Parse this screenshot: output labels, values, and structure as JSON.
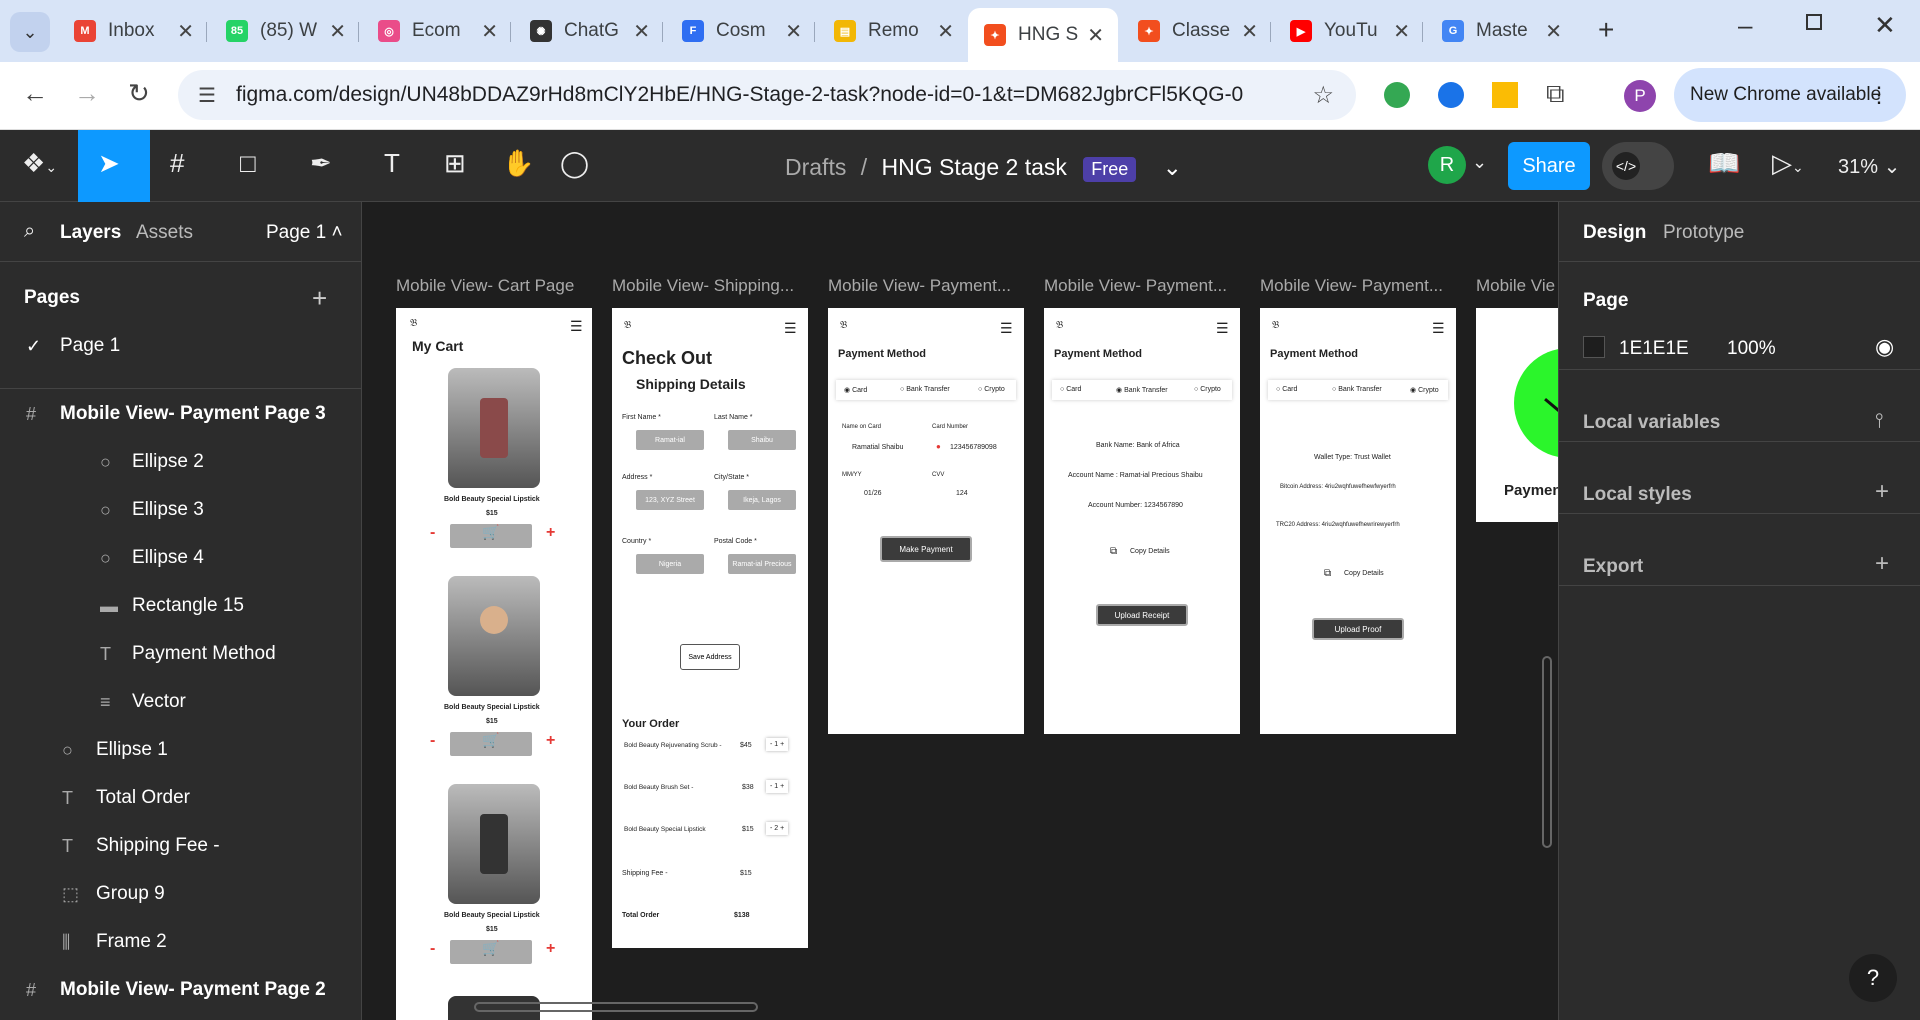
{
  "browser": {
    "tabs": [
      {
        "label": "Inbox",
        "color": "#ea4335",
        "glyph": "M"
      },
      {
        "label": "(85) W",
        "color": "#25d366",
        "glyph": "85"
      },
      {
        "label": "Ecom",
        "color": "#ea4c89",
        "glyph": "◎"
      },
      {
        "label": "ChatG",
        "color": "#333333",
        "glyph": "✺"
      },
      {
        "label": "Cosm",
        "color": "#2f6ef2",
        "glyph": "F"
      },
      {
        "label": "Remo",
        "color": "#f2b705",
        "glyph": "▤"
      },
      {
        "label": "HNG S",
        "color": "#f24e1e",
        "glyph": "✦"
      },
      {
        "label": "Classe",
        "color": "#f24e1e",
        "glyph": "✦"
      },
      {
        "label": "YouTu",
        "color": "#ff0000",
        "glyph": "▶"
      },
      {
        "label": "Maste",
        "color": "#4285f4",
        "glyph": "G"
      }
    ],
    "url": "figma.com/design/UN48bDDAZ9rHd8mClY2HbE/HNG-Stage-2-task?node-id=0-1&t=DM682JgbrCFl5KQG-0",
    "new_chrome": "New Chrome available",
    "profile_initial": "P"
  },
  "figma": {
    "breadcrumb_drafts": "Drafts",
    "separator": "/",
    "file_name": "HNG Stage 2 task",
    "plan_badge": "Free",
    "user_initial": "R",
    "share": "Share",
    "zoom": "31%"
  },
  "left": {
    "tab_layers": "Layers",
    "tab_assets": "Assets",
    "page_selector": "Page 1",
    "pages_heading": "Pages",
    "current_page": "Page 1",
    "layers": [
      {
        "label": "Mobile View- Payment Page 3",
        "icon": "#",
        "indent": 0,
        "bold": true
      },
      {
        "label": "Ellipse 2",
        "icon": "○",
        "indent": 2
      },
      {
        "label": "Ellipse 3",
        "icon": "○",
        "indent": 2
      },
      {
        "label": "Ellipse 4",
        "icon": "○",
        "indent": 2
      },
      {
        "label": "Rectangle 15",
        "icon": "▬",
        "indent": 2
      },
      {
        "label": "Payment Method",
        "icon": "T",
        "indent": 2
      },
      {
        "label": "Vector",
        "icon": "≡",
        "indent": 2
      },
      {
        "label": "Ellipse 1",
        "icon": "○",
        "indent": 1
      },
      {
        "label": "Total Order",
        "icon": "T",
        "indent": 1
      },
      {
        "label": "Shipping Fee -",
        "icon": "T",
        "indent": 1
      },
      {
        "label": "Group 9",
        "icon": "⬚",
        "indent": 1
      },
      {
        "label": "Frame 2",
        "icon": "⫼",
        "indent": 1
      },
      {
        "label": "Mobile View- Payment Page 2",
        "icon": "#",
        "indent": 0,
        "bold": true
      }
    ]
  },
  "canvas": {
    "frame_labels": [
      "Mobile View- Cart Page",
      "Mobile View- Shipping...",
      "Mobile View- Payment...",
      "Mobile View- Payment...",
      "Mobile View- Payment...",
      "Mobile Vie"
    ],
    "cart": {
      "title": "My Cart",
      "items": [
        {
          "name": "Bold Beauty Special Lipstick",
          "price": "$15"
        },
        {
          "name": "Bold Beauty Special Lipstick",
          "price": "$15"
        },
        {
          "name": "Bold Beauty Special Lipstick",
          "price": "$15"
        }
      ],
      "minus": "-",
      "plus": "+"
    },
    "shipping": {
      "title": "Check Out",
      "subtitle": "Shipping Details",
      "labels": [
        "First Name *",
        "Last Name *",
        "Address *",
        "City/State *",
        "Country *",
        "Postal Code *"
      ],
      "values": [
        "Ramat-ial",
        "Shaibu",
        "123, XYZ Street",
        "Ikeja, Lagos",
        "Nigeria",
        "Ramat-ial Precious"
      ],
      "save": "Save Address",
      "your_order": "Your Order",
      "orders": [
        {
          "name": "Bold Beauty Rejuvenating Scrub -",
          "price": "$45",
          "qty": "- 1 +"
        },
        {
          "name": "Bold Beauty Brush Set -",
          "price": "$38",
          "qty": "- 1 +"
        },
        {
          "name": "Bold Beauty Special Lipstick",
          "price": "$15",
          "qty": "- 2 +"
        }
      ],
      "shipping_fee": "Shipping Fee -",
      "shipping_fee_val": "$15",
      "total": "Total Order",
      "total_val": "$138"
    },
    "pay1": {
      "title": "Payment Method",
      "options": [
        "Card",
        "Bank Transfer",
        "Crypto"
      ],
      "name_label": "Name on Card",
      "name_val": "Ramatial Shaibu",
      "card_label": "Card Number",
      "card_val": "123456789098",
      "mm_label": "MM/YY",
      "mm_val": "01/26",
      "cvv_label": "CVV",
      "cvv_val": "124",
      "button": "Make Payment"
    },
    "pay2": {
      "title": "Payment Method",
      "options": [
        "Card",
        "Bank Transfer",
        "Crypto"
      ],
      "bank": "Bank Name: Bank of Africa",
      "acct_name": "Account Name : Ramat-ial Precious Shaibu",
      "acct_num": "Account Number: 1234567890",
      "copy": "Copy Details",
      "button": "Upload Receipt"
    },
    "pay3": {
      "title": "Payment Method",
      "options": [
        "Card",
        "Bank Transfer",
        "Crypto"
      ],
      "wallet": "Wallet Type: Trust Wallet",
      "btc": "Bitcoin Address: 4riu2wqhfuwefhewfwyerfrh",
      "trc": "TRC20 Address: 4riu2wqhfuwefhewrirewyerfrh",
      "copy": "Copy Details",
      "button": "Upload Proof"
    },
    "partial": {
      "label": "Paymen"
    }
  },
  "right": {
    "tab_design": "Design",
    "tab_prototype": "Prototype",
    "page_heading": "Page",
    "bg_hex": "1E1E1E",
    "bg_opacity": "100%",
    "local_variables": "Local variables",
    "local_styles": "Local styles",
    "export": "Export"
  }
}
